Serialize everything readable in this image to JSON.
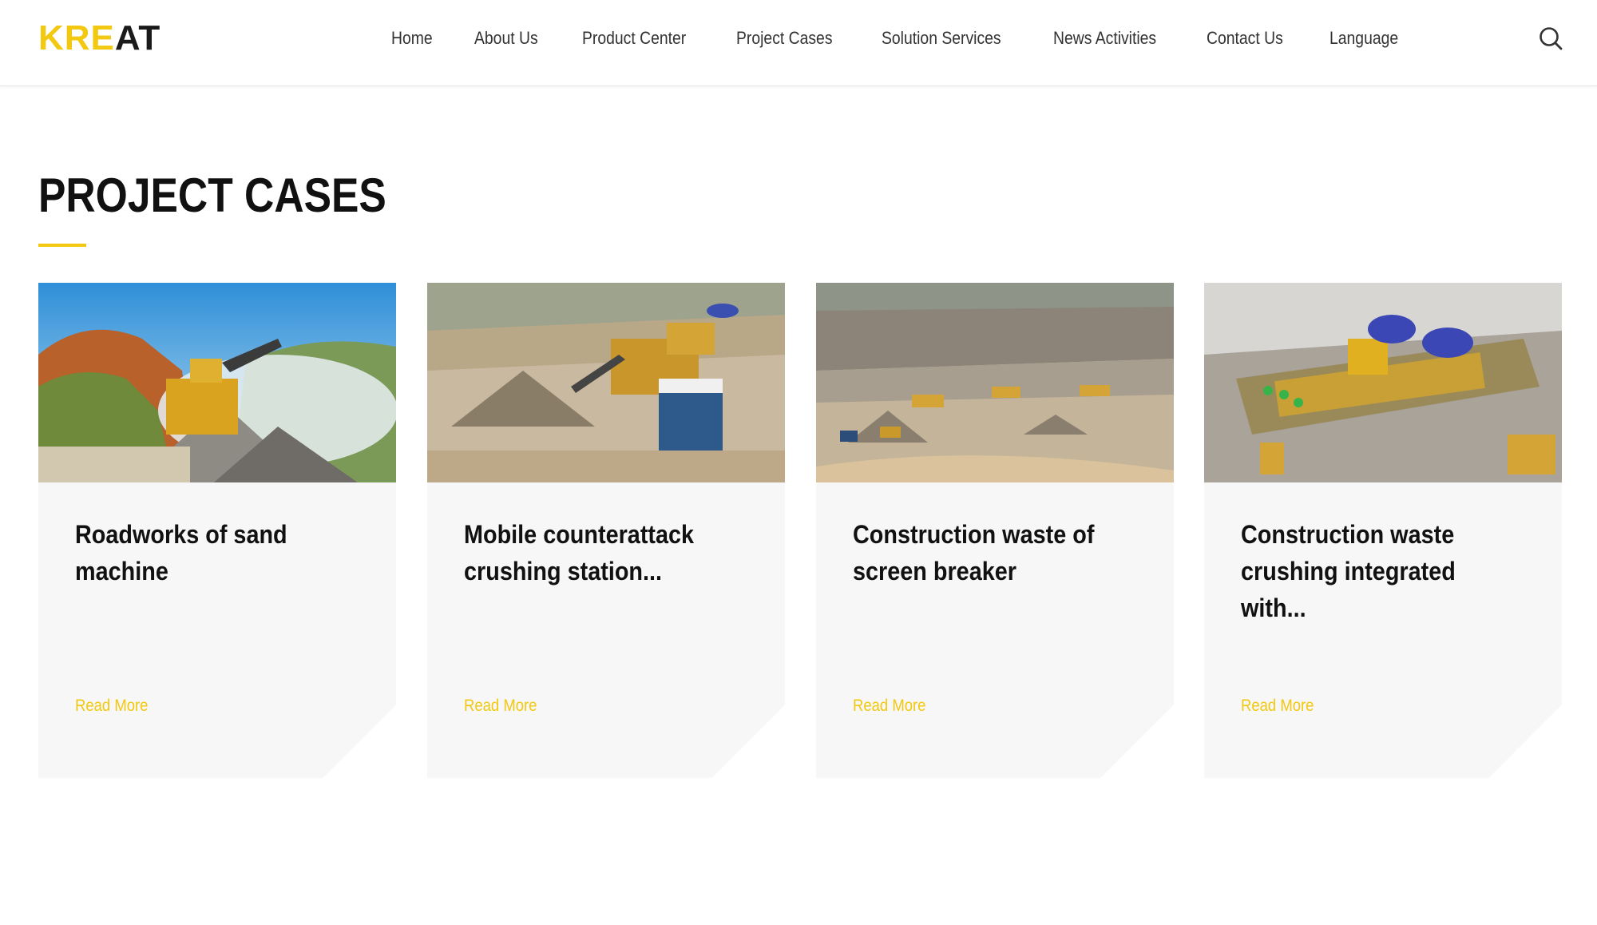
{
  "header": {
    "logo": {
      "part1": "KRE",
      "part2": "AT"
    },
    "nav": [
      {
        "label": "Home"
      },
      {
        "label": "About Us"
      },
      {
        "label": "Product Center"
      },
      {
        "label": "Project Cases"
      },
      {
        "label": "Solution Services"
      },
      {
        "label": "News Activities"
      },
      {
        "label": "Contact Us"
      },
      {
        "label": "Language"
      }
    ],
    "search_icon": "search-icon"
  },
  "section": {
    "title": "PROJECT CASES"
  },
  "cards": [
    {
      "title": "Roadworks of sand machine",
      "read_more": "Read More",
      "image": "mobile-crusher-on-hillside-photo"
    },
    {
      "title": "Mobile counterattack crushing station...",
      "read_more": "Read More",
      "image": "crushing-station-site-photo"
    },
    {
      "title": "Construction waste of screen breaker",
      "read_more": "Read More",
      "image": "quarry-aerial-photo"
    },
    {
      "title": "Construction waste crushing integrated with...",
      "read_more": "Read More",
      "image": "crushing-plant-aerial-photo"
    }
  ],
  "colors": {
    "accent": "#f2c811",
    "text": "#111111",
    "card_bg": "#f7f7f7"
  }
}
